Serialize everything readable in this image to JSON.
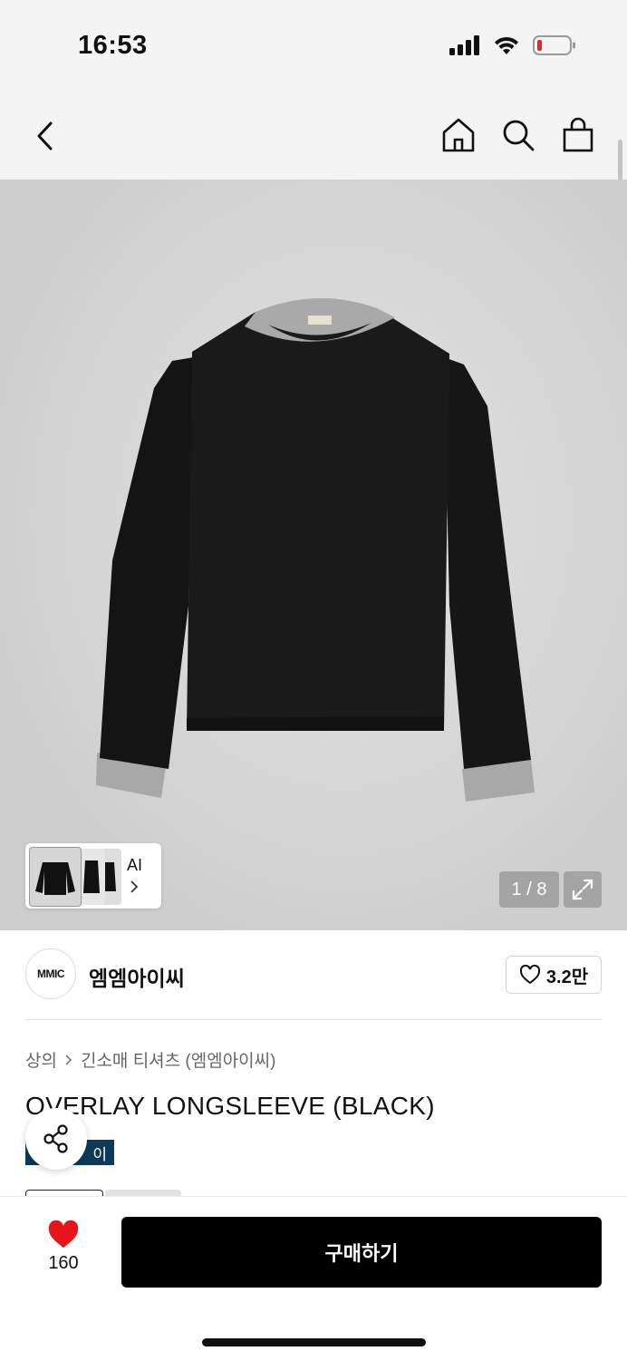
{
  "status_bar": {
    "time": "16:53"
  },
  "icons": {
    "back": "chevron-left-icon",
    "home": "home-icon",
    "search": "search-icon",
    "cart": "shopping-bag-icon",
    "expand": "expand-icon",
    "share": "share-icon",
    "heart": "heart-icon"
  },
  "gallery": {
    "counter": "1 / 8",
    "ai_label": "AI"
  },
  "brand": {
    "logo_text": "MMIC",
    "name": "엠엠아이씨",
    "like_count": "3.2만"
  },
  "breadcrumb": {
    "category": "상의",
    "subcategory": "긴소매 티셔츠 (엠엠아이씨)"
  },
  "product": {
    "title": "OVERLAY LONGSLEEVE (BLACK)",
    "pay_badge": "이"
  },
  "bottom_bar": {
    "wish_count": "160",
    "buy_label": "구매하기"
  },
  "colors": {
    "accent": "#e8141c",
    "badge": "#0d3a57",
    "buy_button": "#000000"
  }
}
